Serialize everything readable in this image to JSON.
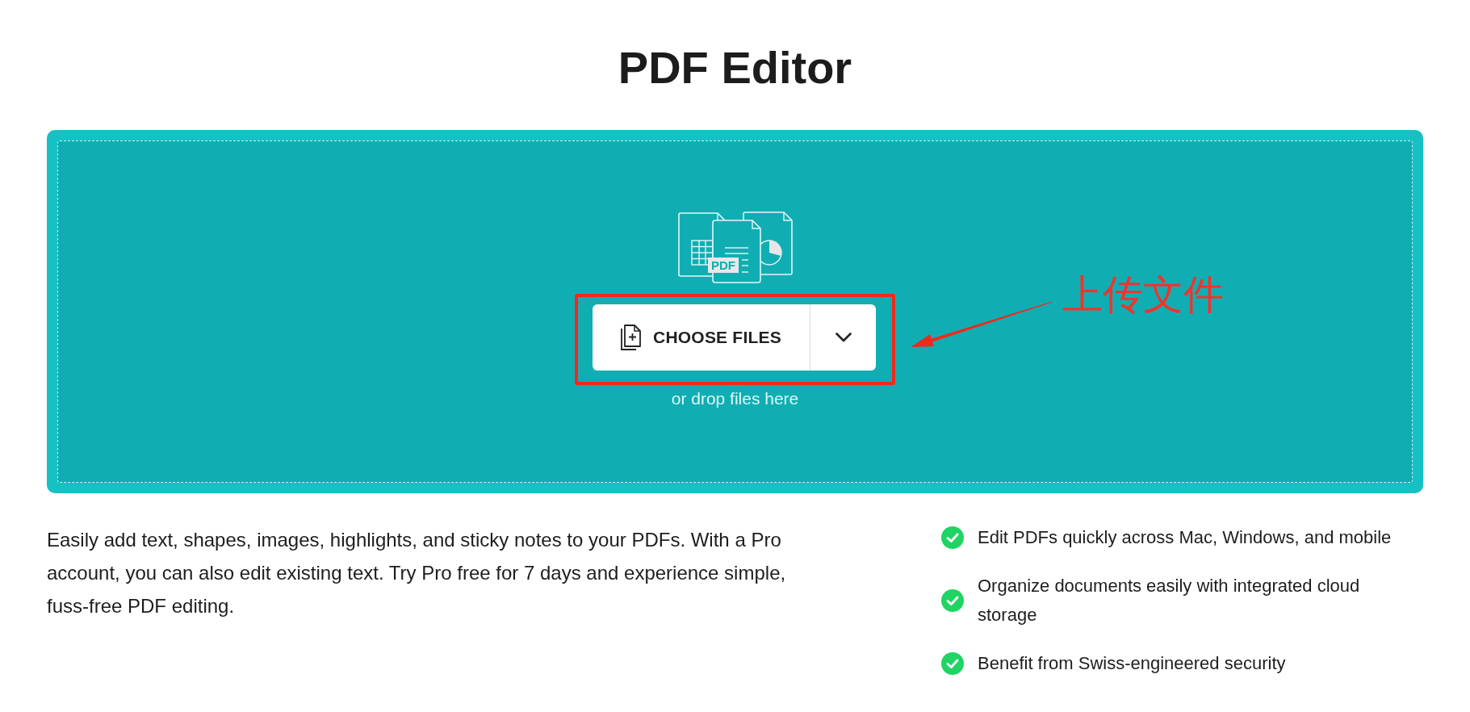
{
  "header": {
    "title": "PDF Editor"
  },
  "upload": {
    "illustration_label": "PDF",
    "button": {
      "label": "CHOOSE FILES"
    },
    "hint": "or drop files here"
  },
  "annotation": {
    "label": "上传文件"
  },
  "description": "Easily add text, shapes, images, highlights, and sticky notes to your PDFs. With a Pro account, you can also edit existing text. Try Pro free for 7 days and experience simple, fuss-free PDF editing.",
  "features": [
    {
      "text": "Edit PDFs quickly across Mac, Windows, and mobile"
    },
    {
      "text": "Organize documents easily with integrated cloud storage"
    },
    {
      "text": "Benefit from Swiss-engineered security"
    }
  ]
}
